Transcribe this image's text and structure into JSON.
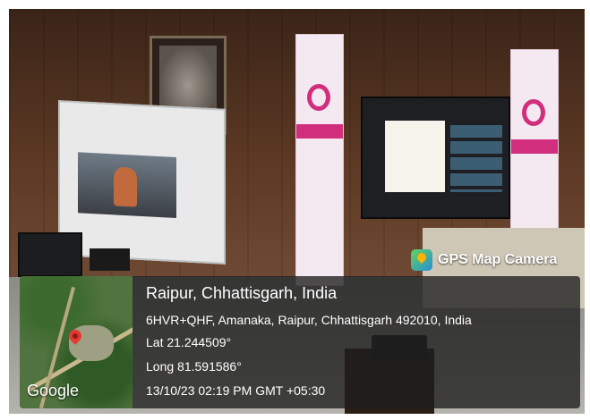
{
  "badge": {
    "label": "GPS Map Camera",
    "icon": "map-pin-icon"
  },
  "map": {
    "attribution": "Google",
    "icon": "location-pin-icon"
  },
  "location": {
    "place": "Raipur, Chhattisgarh, India",
    "address": "6HVR+QHF, Amanaka, Raipur, Chhattisgarh 492010, India",
    "lat": "Lat 21.244509°",
    "long": "Long 81.591586°",
    "datetime": "13/10/23 02:19 PM GMT +05:30"
  },
  "colors": {
    "banner_accent": "#d12f7d",
    "overlay": "#1e1e1e"
  }
}
